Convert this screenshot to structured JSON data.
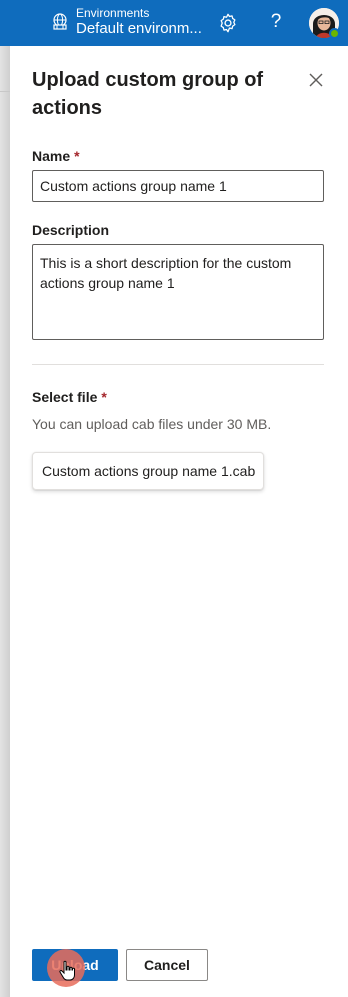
{
  "topbar": {
    "env_label": "Environments",
    "env_value": "Default environm...",
    "icons": {
      "environment": "globe-building-icon",
      "settings": "gear-icon",
      "help": "question-icon",
      "avatar": "user-avatar",
      "presence": "presence-available"
    },
    "help_glyph": "?"
  },
  "panel": {
    "title": "Upload custom group of actions",
    "name_label": "Name",
    "name_required": "*",
    "name_value": "Custom actions group name 1",
    "description_label": "Description",
    "description_value": "This is a short description for the custom actions group name 1",
    "select_file_label": "Select file",
    "select_file_required": "*",
    "hint": "You can upload cab files under 30 MB.",
    "file_name": "Custom actions group name 1.cab",
    "upload_label": "Upload",
    "cancel_label": "Cancel"
  },
  "colors": {
    "brand": "#0f6cbd",
    "required": "#a4262c",
    "presence": "#6bb700",
    "click_marker": "#e86c5a"
  }
}
